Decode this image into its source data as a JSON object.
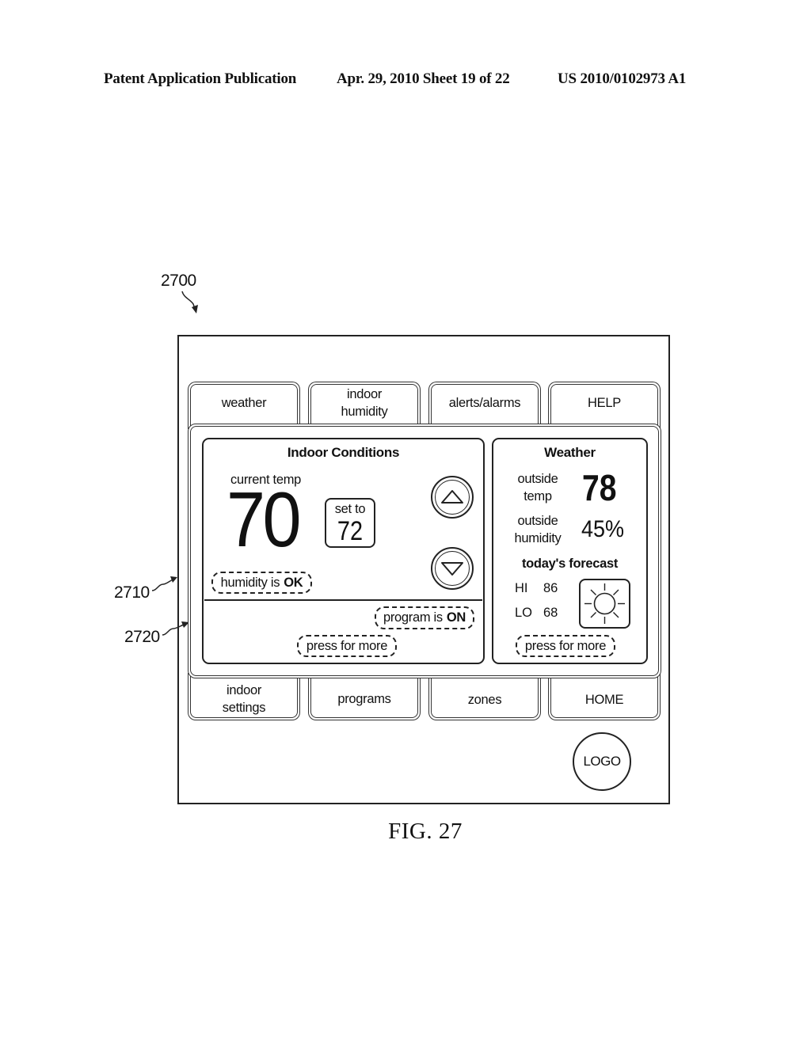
{
  "header": {
    "publication": "Patent Application Publication",
    "date_sheet": "Apr. 29, 2010  Sheet 19 of 22",
    "patent_number": "US 2010/0102973 A1"
  },
  "reference_labels": {
    "device": "2700",
    "outer_screen": "2710",
    "inner_screen": "2720"
  },
  "top_tabs": [
    {
      "label": "weather"
    },
    {
      "label": "indoor\nhumidity"
    },
    {
      "label": "alerts/alarms"
    },
    {
      "label": "HELP"
    }
  ],
  "bottom_tabs": [
    {
      "label": "indoor\nsettings"
    },
    {
      "label": "programs"
    },
    {
      "label": "zones"
    },
    {
      "label": "HOME"
    }
  ],
  "indoor": {
    "title": "Indoor Conditions",
    "current_temp_label": "current temp",
    "current_temp": "70",
    "set_to_label": "set to",
    "set_to_value": "72",
    "humidity_status_prefix": "humidity is",
    "humidity_status_value": "OK",
    "program_status_prefix": "program is",
    "program_status_value": "ON",
    "more_button": "press for more",
    "up_icon": "triangle-up",
    "down_icon": "triangle-down"
  },
  "weather": {
    "title": "Weather",
    "outside_temp_label_1": "outside",
    "outside_temp_label_2": "temp",
    "outside_temp": "78",
    "outside_humidity_label_1": "outside",
    "outside_humidity_label_2": "humidity",
    "outside_humidity": "45%",
    "forecast_title": "today's forecast",
    "hi_label": "HI",
    "hi_value": "86",
    "lo_label": "LO",
    "lo_value": "68",
    "forecast_icon": "sun",
    "more_button": "press for more"
  },
  "logo": "LOGO",
  "figure_caption": "FIG. 27"
}
